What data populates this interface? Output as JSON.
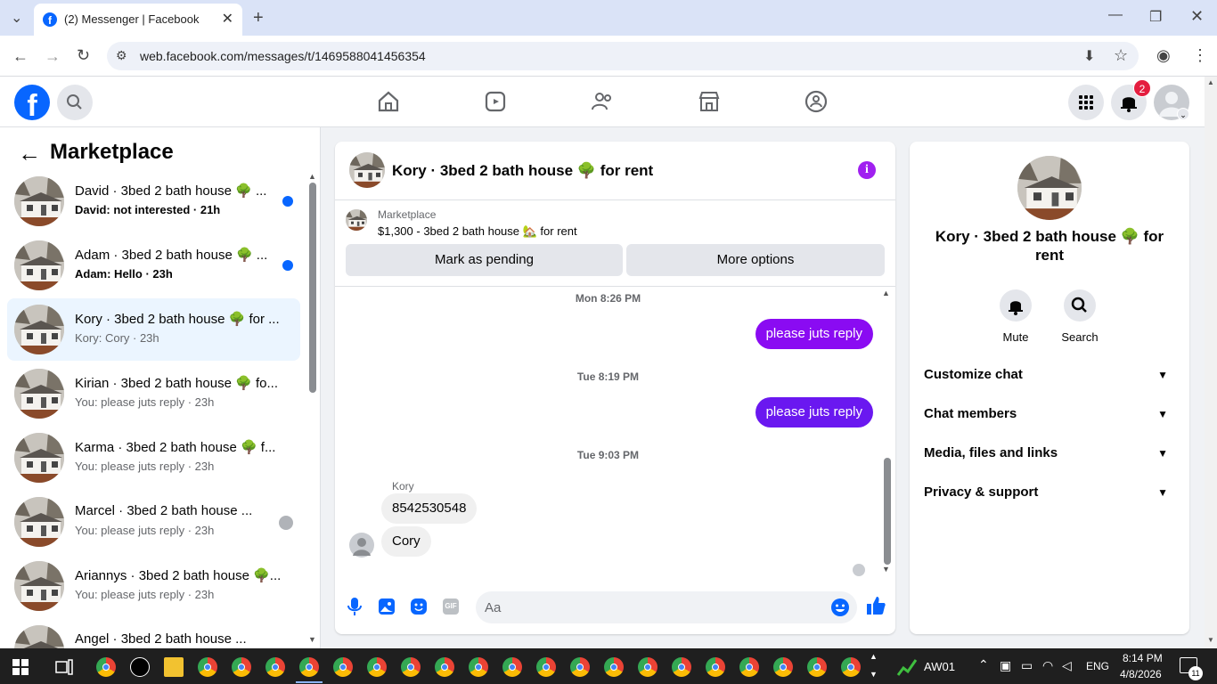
{
  "browser": {
    "tab_title": "(2) Messenger | Facebook",
    "url": "web.facebook.com/messages/t/1469588041456354"
  },
  "header": {
    "notification_count": "2"
  },
  "sidebar": {
    "title": "Marketplace",
    "conversations": [
      {
        "name": "David · 3bed 2 bath house 🌳 ...",
        "snippet": "David: not interested · 21h",
        "unread": true
      },
      {
        "name": "Adam · 3bed 2 bath house 🌳 ...",
        "snippet": "Adam: Hello · 23h",
        "unread": true
      },
      {
        "name": "Kory · 3bed 2 bath house 🌳 for ...",
        "snippet": "Kory: Cory · 23h",
        "unread": false
      },
      {
        "name": "Kirian · 3bed 2 bath house 🌳 fo...",
        "snippet": "You: please juts reply · 23h",
        "unread": false
      },
      {
        "name": "Karma · 3bed 2 bath house 🌳 f...",
        "snippet": "You: please juts reply · 23h",
        "unread": false
      },
      {
        "name": "Marcel · 3bed 2 bath house ...",
        "snippet": "You: please juts reply · 23h",
        "unread": false
      },
      {
        "name": "Ariannys · 3bed 2 bath house 🌳...",
        "snippet": "You: please juts reply · 23h",
        "unread": false
      },
      {
        "name": "Angel · 3bed 2 bath house ...",
        "snippet": "",
        "unread": false
      }
    ]
  },
  "chat": {
    "title": "Kory · 3bed 2 bath house 🌳 for rent",
    "marketplace_label": "Marketplace",
    "listing": "$1,300 - 3bed 2 bath house 🏡 for rent",
    "mark_pending": "Mark as pending",
    "more_options": "More options",
    "messages": {
      "ts1": "Mon 8:26 PM",
      "out1": "please juts reply",
      "ts2": "Tue 8:19 PM",
      "out2": "please juts reply",
      "ts3": "Tue 9:03 PM",
      "sender": "Kory",
      "in1": "8542530548",
      "in2": "Cory"
    },
    "composer_placeholder": "Aa"
  },
  "rpanel": {
    "name": "Kory · 3bed 2 bath house 🌳 for rent",
    "mute": "Mute",
    "search": "Search",
    "rows": [
      "Customize chat",
      "Chat members",
      "Media, files and links",
      "Privacy & support"
    ]
  },
  "taskbar": {
    "aw": "AW01",
    "lang": "ENG",
    "time": "8:14 PM",
    "date": "4/8/2026",
    "notif": "11"
  },
  "colors": {
    "accent": "#0866ff",
    "bubble_out": "#8a0bf2",
    "info": "#a020f0"
  }
}
